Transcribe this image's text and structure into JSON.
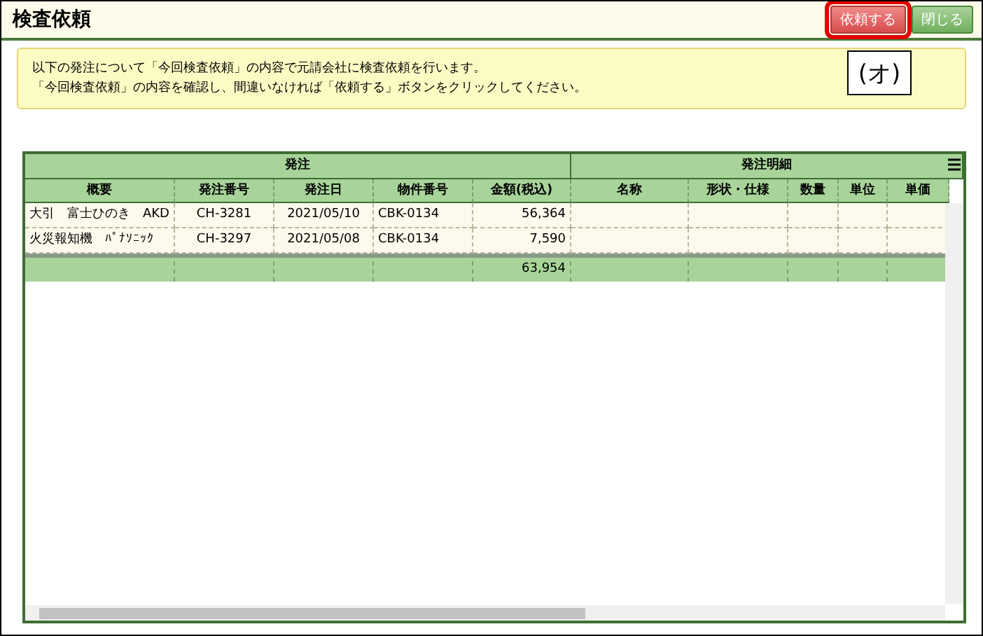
{
  "window": {
    "title": "検査依頼"
  },
  "buttons": [
    {
      "label": "依頼する",
      "kind": "primary",
      "highlighted": true
    },
    {
      "label": "閉じる",
      "kind": "secondary",
      "highlighted": false
    }
  ],
  "annotation": "(オ)",
  "message": [
    "以下の発注について「今回検査依頼」の内容で元請会社に検査依頼を行います。",
    "「今回検査依頼」の内容を確認し、間違いなければ「依頼する」ボタンをクリックしてください。"
  ],
  "table": {
    "groups": [
      "発注",
      "発注明細"
    ],
    "columns": [
      "概要",
      "発注番号",
      "発注日",
      "物件番号",
      "金額(税込)",
      "名称",
      "形状・仕様",
      "数量",
      "単位",
      "単価"
    ],
    "rows": [
      [
        "大引　富士ひのき　AKD",
        "CH-3281",
        "2021/05/10",
        "CBK-0134",
        "56,364"
      ],
      [
        "火災報知機　ﾊﾟﾅｿﾆｯｸ",
        "CH-3297",
        "2021/05/08",
        "CBK-0134",
        "7,590"
      ]
    ],
    "total_amount": "63,954"
  }
}
